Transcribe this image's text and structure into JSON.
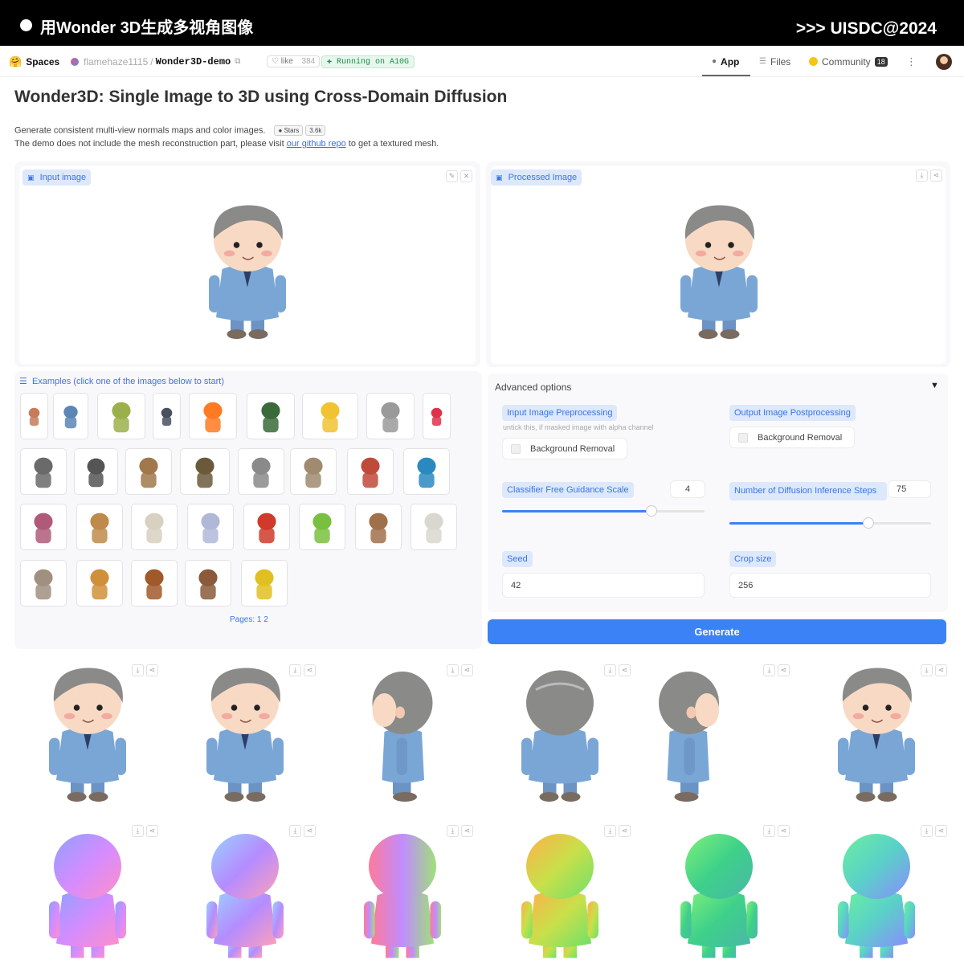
{
  "banner": {
    "title": "用Wonder 3D生成多视角图像",
    "credit": ">>> UISDC@2024"
  },
  "hf_header": {
    "spaces_label": "Spaces",
    "owner": "flamehaze1115",
    "separator": "/",
    "repo": "Wonder3D-demo",
    "like_label": "like",
    "like_count": "384",
    "running": "Running on A10G",
    "tabs": [
      {
        "label": "App",
        "active": true
      },
      {
        "label": "Files",
        "active": false
      },
      {
        "label": "Community",
        "active": false
      }
    ],
    "community_count": "18"
  },
  "page": {
    "title": "Wonder3D: Single Image to 3D using Cross-Domain Diffusion",
    "desc_line1": "Generate consistent multi-view normals maps and color images.",
    "stars_label": "Stars",
    "stars_count": "3.6k",
    "desc_line2_pre": "The demo does not include the mesh reconstruction part, please visit ",
    "desc_link": "our github repo",
    "desc_line2_post": " to get a textured mesh."
  },
  "input_panel": {
    "label": "Input image"
  },
  "processed_panel": {
    "label": "Processed Image"
  },
  "examples": {
    "label": "Examples (click one of the images below to start)",
    "items": [
      "monkey-figure",
      "cat-shirt",
      "avocado-chair",
      "armored-warrior",
      "firefox-logo",
      "chimp-warrior",
      "minion",
      "tiger-head",
      "powerpuff-girl",
      "dog",
      "elephant",
      "camel",
      "tortoise",
      "koala",
      "rabbit",
      "teddy-bear",
      "kingfisher",
      "treasure-chest",
      "bread-basket",
      "cat",
      "cartoon-cat",
      "apple",
      "cat-figure",
      "monkey",
      "alpaca",
      "robot-toy",
      "fox-tpose",
      "fox",
      "groot",
      "spongebob"
    ],
    "pages": "Pages: 1 2"
  },
  "advanced": {
    "title": "Advanced options",
    "preprocessing_label": "Input Image Preprocessing",
    "preprocessing_hint": "untick this, if masked image with alpha channel",
    "bg_removal_input": "Background Removal",
    "postprocessing_label": "Output Image Postprocessing",
    "bg_removal_output": "Background Removal",
    "cfg_label": "Classifier Free Guidance Scale",
    "cfg_value": "4",
    "cfg_fraction": 0.74,
    "steps_label": "Number of Diffusion Inference Steps",
    "steps_value": "75",
    "steps_fraction": 0.69,
    "seed_label": "Seed",
    "seed_value": "42",
    "crop_label": "Crop size",
    "crop_value": "256"
  },
  "generate_label": "Generate",
  "outputs": {
    "color_views": [
      "front",
      "front-right",
      "right",
      "back",
      "left",
      "front-left"
    ],
    "normal_views": [
      "front",
      "front-right",
      "right",
      "back",
      "left",
      "front-left"
    ]
  },
  "colors": {
    "accent": "#3b82f6",
    "label_bg": "#dde8fb",
    "label_fg": "#3b75e3",
    "running": "#1a8b45"
  }
}
